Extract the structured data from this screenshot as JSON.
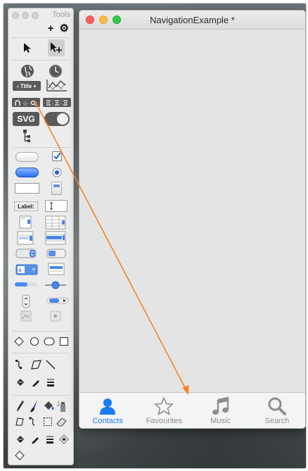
{
  "tools_panel": {
    "title": "Tools",
    "add_icon": "plus-icon",
    "settings_icon": "gear-icon",
    "title_button_label": "Title",
    "svg_label": "SVG",
    "label_label": "Label:"
  },
  "window": {
    "title": "NavigationExample *"
  },
  "tabbar": {
    "tabs": [
      {
        "label": "Contacts",
        "icon": "person-icon",
        "active": true
      },
      {
        "label": "Favourites",
        "icon": "star-icon",
        "active": false
      },
      {
        "label": "Music",
        "icon": "music-note-icon",
        "active": false
      },
      {
        "label": "Search",
        "icon": "search-icon",
        "active": false
      }
    ]
  },
  "colors": {
    "accent": "#1a7cf2",
    "arrow": "#f5841f",
    "inactive_tab": "#8e8e8e"
  }
}
